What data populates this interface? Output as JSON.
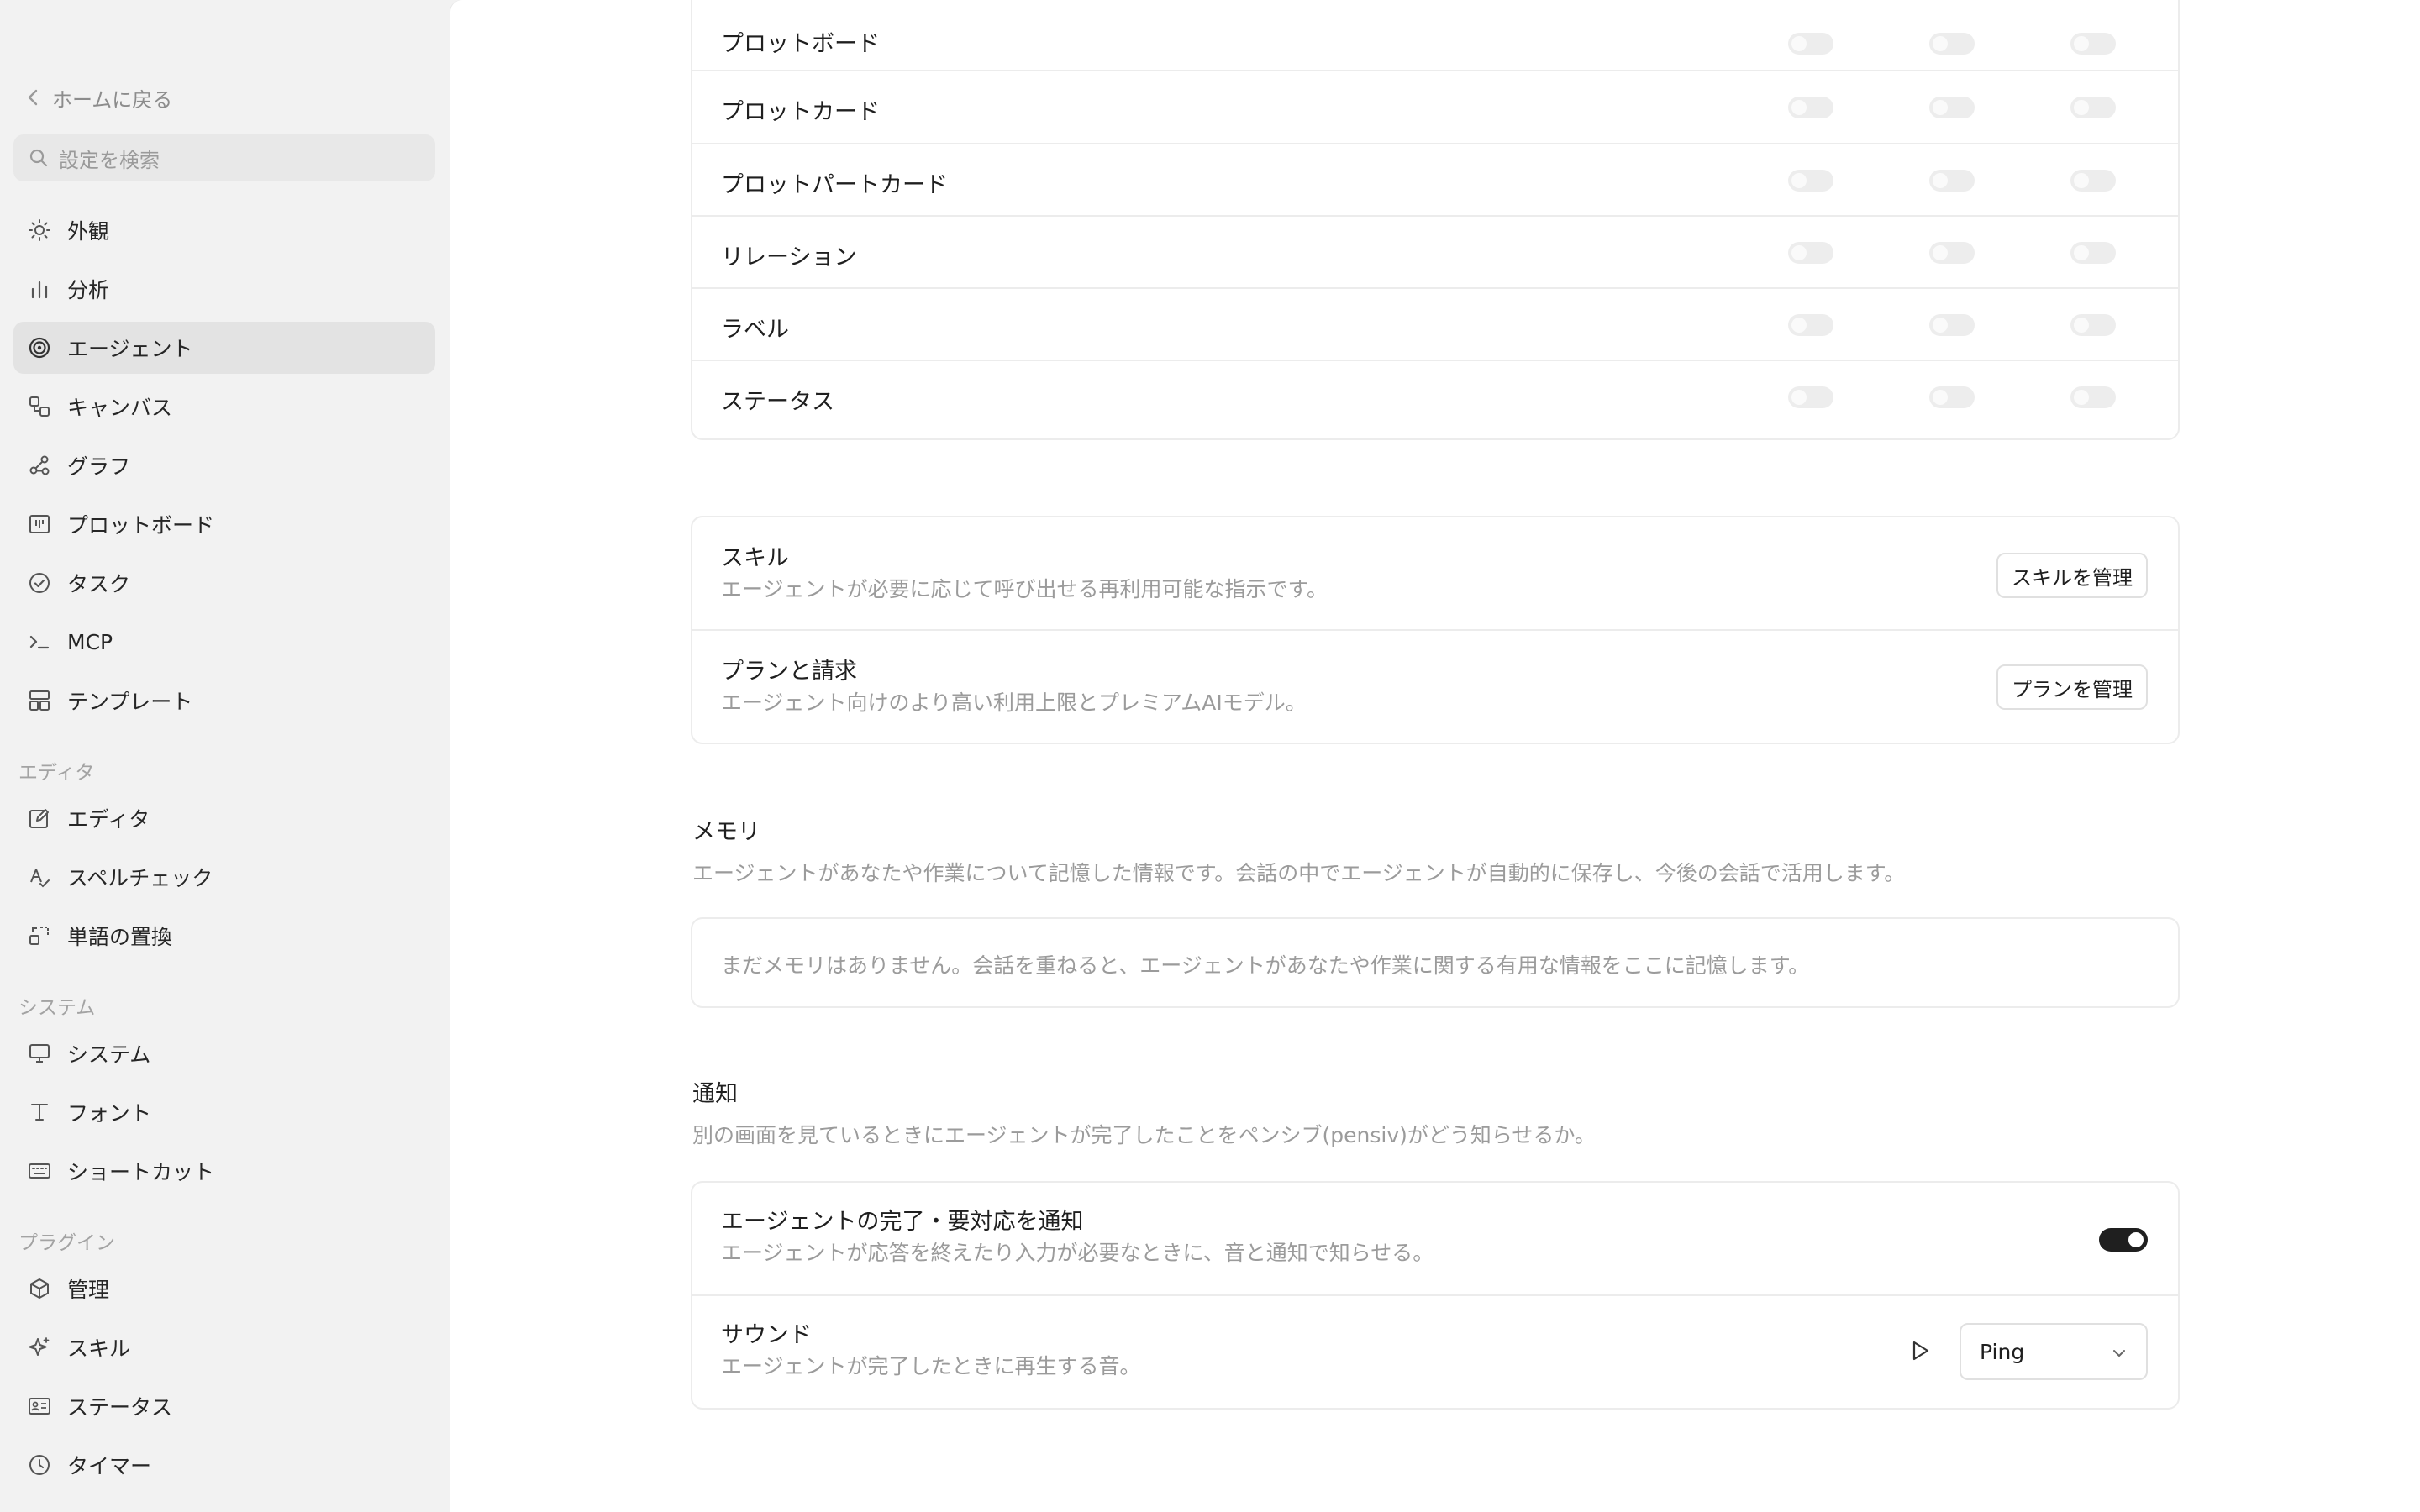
{
  "sidebar": {
    "back_label": "ホームに戻る",
    "search_placeholder": "設定を検索",
    "items": [
      {
        "label": "外観",
        "icon": "sun-icon"
      },
      {
        "label": "分析",
        "icon": "bar-chart-icon"
      },
      {
        "label": "エージェント",
        "icon": "spiral-icon",
        "active": true
      },
      {
        "label": "キャンバス",
        "icon": "shapes-icon"
      },
      {
        "label": "グラフ",
        "icon": "graph-icon"
      },
      {
        "label": "プロットボード",
        "icon": "board-icon"
      },
      {
        "label": "タスク",
        "icon": "check-circle-icon"
      },
      {
        "label": "MCP",
        "icon": "terminal-icon"
      },
      {
        "label": "テンプレート",
        "icon": "template-icon"
      }
    ],
    "editor_section": "エディタ",
    "editor_items": [
      {
        "label": "エディタ",
        "icon": "edit-icon"
      },
      {
        "label": "スペルチェック",
        "icon": "spellcheck-icon"
      },
      {
        "label": "単語の置換",
        "icon": "replace-icon"
      }
    ],
    "system_section": "システム",
    "system_items": [
      {
        "label": "システム",
        "icon": "monitor-icon"
      },
      {
        "label": "フォント",
        "icon": "font-icon"
      },
      {
        "label": "ショートカット",
        "icon": "keyboard-icon"
      }
    ],
    "plugin_section": "プラグイン",
    "plugin_items": [
      {
        "label": "管理",
        "icon": "package-icon"
      },
      {
        "label": "スキル",
        "icon": "sparkle-icon"
      },
      {
        "label": "ステータス",
        "icon": "id-card-icon"
      },
      {
        "label": "タイマー",
        "icon": "clock-icon"
      }
    ]
  },
  "permissions": {
    "rows": [
      {
        "label": "プロットボード",
        "toggles": [
          false,
          false,
          false
        ]
      },
      {
        "label": "プロットカード",
        "toggles": [
          false,
          false,
          false
        ]
      },
      {
        "label": "プロットパートカード",
        "toggles": [
          false,
          false,
          false
        ]
      },
      {
        "label": "リレーション",
        "toggles": [
          false,
          false,
          false
        ]
      },
      {
        "label": "ラベル",
        "toggles": [
          false,
          false,
          false
        ]
      },
      {
        "label": "ステータス",
        "toggles": [
          false,
          false,
          false
        ]
      }
    ]
  },
  "skills": {
    "title": "スキル",
    "description": "エージェントが必要に応じて呼び出せる再利用可能な指示です。",
    "button": "スキルを管理"
  },
  "plan": {
    "title": "プランと請求",
    "description": "エージェント向けのより高い利用上限とプレミアムAIモデル。",
    "button": "プランを管理"
  },
  "memory": {
    "title": "メモリ",
    "description": "エージェントがあなたや作業について記憶した情報です。会話の中でエージェントが自動的に保存し、今後の会話で活用します。",
    "empty": "まだメモリはありません。会話を重ねると、エージェントがあなたや作業に関する有用な情報をここに記憶します。"
  },
  "notifications": {
    "title": "通知",
    "description": "別の画面を見ているときにエージェントが完了したことをペンシブ(pensiv)がどう知らせるか。",
    "notify_title": "エージェントの完了・要対応を通知",
    "notify_desc": "エージェントが応答を終えたり入力が必要なときに、音と通知で知らせる。",
    "notify_enabled": true,
    "sound_title": "サウンド",
    "sound_desc": "エージェントが完了したときに再生する音。",
    "sound_value": "Ping"
  }
}
